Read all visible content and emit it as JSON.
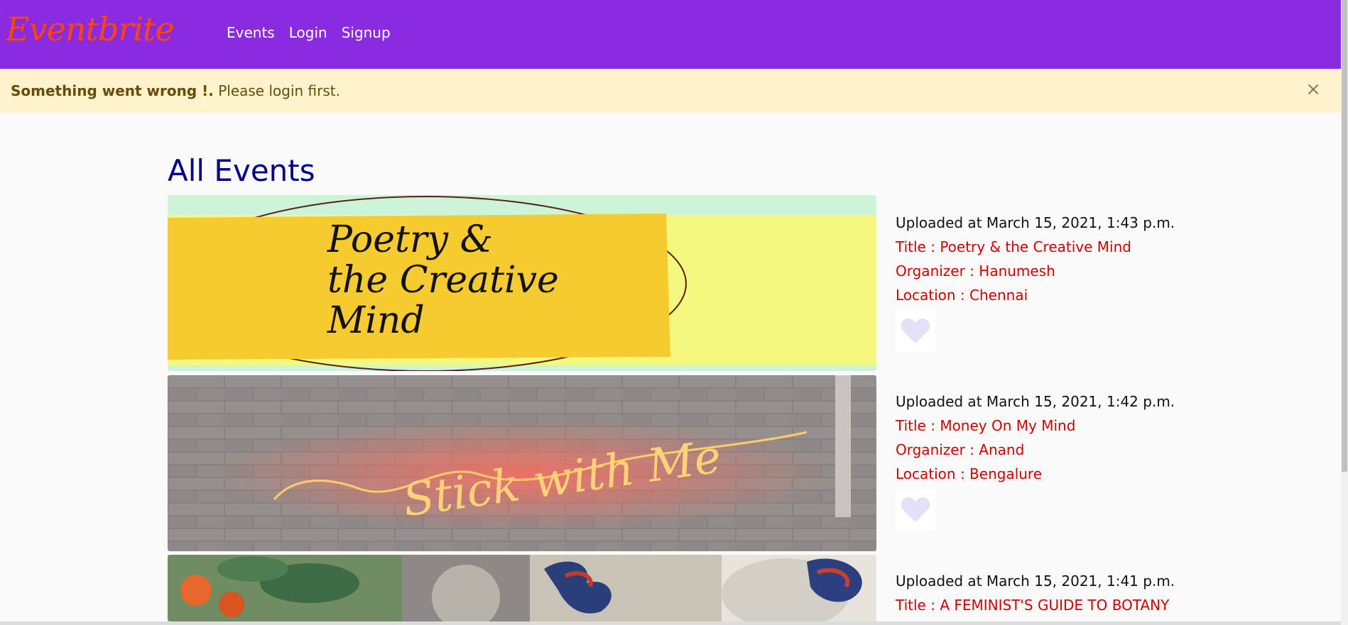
{
  "nav": {
    "brand": "Eventbrite",
    "links": [
      "Events",
      "Login",
      "Signup"
    ]
  },
  "alert": {
    "strong": "Something went wrong !.",
    "text": " Please login first.",
    "close": "×"
  },
  "page_title": "All Events",
  "events": [
    {
      "uploaded": "Uploaded at March 15, 2021, 1:43 p.m.",
      "title": "Title : Poetry & the Creative Mind",
      "organizer": "Organizer : Hanumesh",
      "location": "Location : Chennai",
      "banner_lines": [
        "Poetry &",
        "the Creative",
        "Mind"
      ]
    },
    {
      "uploaded": "Uploaded at March 15, 2021, 1:42 p.m.",
      "title": "Title : Money On My Mind",
      "organizer": "Organizer : Anand",
      "location": "Location : Bengalure",
      "banner_lines": [
        "Stick with Me"
      ]
    },
    {
      "uploaded": "Uploaded at March 15, 2021, 1:41 p.m.",
      "title": "Title : A FEMINIST'S GUIDE TO BOTANY"
    }
  ],
  "colors": {
    "navbar": "#8a2be2",
    "brand": "#ff4500",
    "alert_bg": "#fff3cd",
    "heading": "#00008b",
    "detail_text": "#cc0000",
    "heart": "#e3e1f7"
  }
}
